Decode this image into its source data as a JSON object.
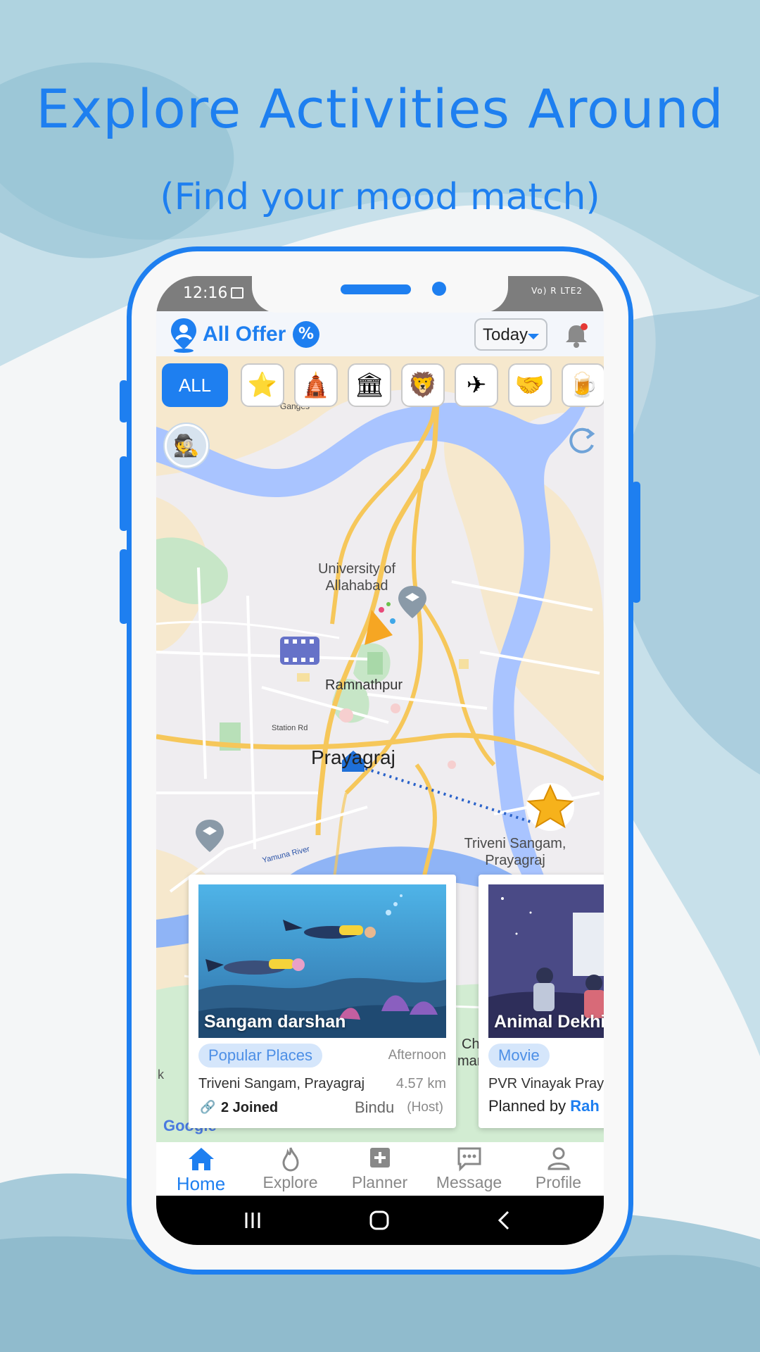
{
  "headline": {
    "title": "Explore Activities Around",
    "subtitle": "(Find your mood match)"
  },
  "colors": {
    "accent": "#1e7ff0",
    "tag_bg": "#d5e6fb",
    "water": "#a9c4ff",
    "road": "#f6c75a"
  },
  "status_bar": {
    "time": "12:16",
    "right_icons": "Vo) R  LTE2"
  },
  "app": {
    "title": "All Offer",
    "badge_icon": "percent-badge-icon",
    "date_filter": "Today",
    "bell_icon": "bell-icon"
  },
  "categories": {
    "all_label": "ALL",
    "items": [
      {
        "name": "star-icon",
        "glyph": "⭐"
      },
      {
        "name": "temple-icon",
        "glyph": "🛕"
      },
      {
        "name": "museum-icon",
        "glyph": "🏛"
      },
      {
        "name": "zoo-icon",
        "glyph": "🦁"
      },
      {
        "name": "airplane-icon",
        "glyph": "✈"
      },
      {
        "name": "meeting-icon",
        "glyph": "🤝"
      },
      {
        "name": "pub-icon",
        "glyph": "🍺"
      }
    ]
  },
  "map": {
    "labels": {
      "ganges": "Ganges",
      "university": "University of Allahabad",
      "ramnathpur": "Ramnathpur",
      "station_rd": "Station Rd",
      "city": "Prayagraj",
      "triveni": "Triveni Sangam, Prayagraj",
      "yamuna": "Yamuna River",
      "partial_ch": "Ch",
      "partial_mar": "mar",
      "partial_k": "k",
      "google": "Google"
    }
  },
  "cards": [
    {
      "title": "Sangam darshan",
      "tag": "Popular Places",
      "time": "Afternoon",
      "location": "Triveni Sangam, Prayagraj",
      "distance": "4.57 km",
      "joined": "2 Joined",
      "host_name": "Bindu",
      "host_label": "(Host)"
    },
    {
      "title": "Animal Dekhi",
      "tag": "Movie",
      "location": "PVR Vinayak Pray",
      "planned_prefix": "Planned by",
      "planned_name": "Rah"
    }
  ],
  "bottom_nav": [
    {
      "label": "Home",
      "icon": "home-icon",
      "active": true
    },
    {
      "label": "Explore",
      "icon": "flame-icon",
      "active": false
    },
    {
      "label": "Planner",
      "icon": "plus-square-icon",
      "active": false
    },
    {
      "label": "Message",
      "icon": "message-icon",
      "active": false
    },
    {
      "label": "Profile",
      "icon": "profile-icon",
      "active": false
    }
  ]
}
